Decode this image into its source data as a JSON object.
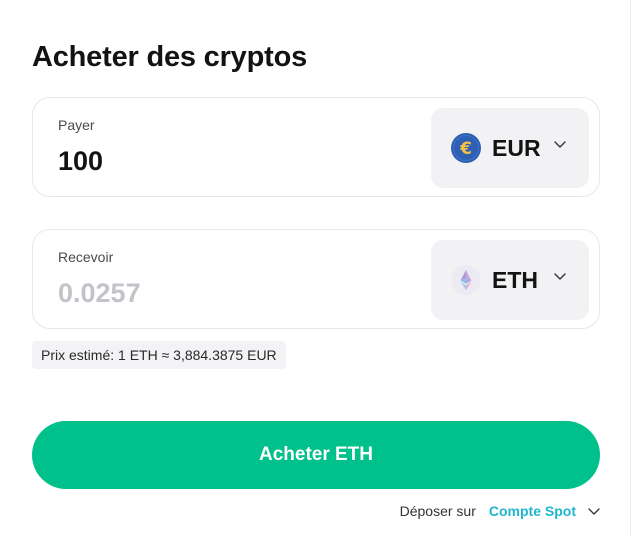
{
  "page_title": "Acheter des cryptos",
  "pay": {
    "label": "Payer",
    "amount": "100",
    "currency": {
      "code": "EUR",
      "icon": "euro-coin-icon",
      "color": "#2f5fb3"
    }
  },
  "receive": {
    "label": "Recevoir",
    "amount_placeholder": "0.0257",
    "currency": {
      "code": "ETH",
      "icon": "ethereum-icon"
    }
  },
  "estimated_price": "Prix estimé: 1 ETH ≈ 3,884.3875 EUR",
  "buy_button_label": "Acheter ETH",
  "deposit": {
    "label": "Déposer sur",
    "account": "Compte Spot"
  },
  "colors": {
    "accent": "#00c08b",
    "link": "#1fb6cf",
    "muted_value": "#c3c3c9"
  }
}
